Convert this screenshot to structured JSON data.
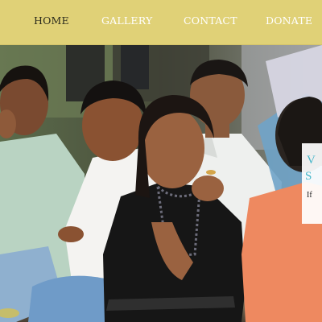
{
  "nav": {
    "items": [
      {
        "label": "HOME",
        "active": true
      },
      {
        "label": "GALLERY",
        "active": false
      },
      {
        "label": "CONTACT",
        "active": false
      },
      {
        "label": "DONATE",
        "active": false
      }
    ],
    "background_color": "#e0d177",
    "active_color": "#2a2a1c",
    "inactive_color": "#ffffff"
  },
  "promo_card": {
    "glyph_1": "V",
    "glyph_2": "S",
    "glyph_3": "If",
    "accent_color": "#45b6c9"
  }
}
